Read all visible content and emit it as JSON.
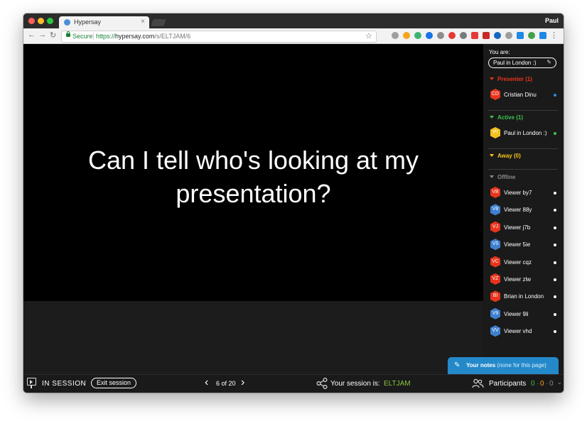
{
  "browser": {
    "user": "Paul",
    "tab_title": "Hypersay",
    "tab_close": "×",
    "secure_label": "Secure",
    "url_scheme": "https://",
    "url_host": "hypersay.com",
    "url_path": "/s/ELTJAM/6",
    "nav_back": "←",
    "nav_forward": "→",
    "nav_reload": "↻",
    "star": "☆",
    "menu": "⋮"
  },
  "slide": {
    "title_line1": "Can I tell who's looking at my",
    "title_line2": "presentation?"
  },
  "sidebar": {
    "you_are_label": "You are:",
    "your_name": "Paul in London :)",
    "edit_icon": "✎",
    "presenter_heading": "Presenter (1)",
    "active_heading": "Active (1)",
    "away_heading": "Away (0)",
    "offline_heading": "Offline",
    "presenter": [
      {
        "initials": "CD",
        "name": "Cristian Dinu",
        "color": "#e8341c",
        "dot": "#2b8fe6"
      }
    ],
    "active": [
      {
        "initials": "PI",
        "name": "Paul in London :)",
        "color": "#f6c21b",
        "dot": "#3cc24b"
      }
    ],
    "offline": [
      {
        "initials": "VB",
        "name": "Viewer by7",
        "color": "#e8341c",
        "dot": "#ffffff"
      },
      {
        "initials": "V8",
        "name": "Viewer 88y",
        "color": "#3f7fcf",
        "dot": "#ffffff"
      },
      {
        "initials": "VJ",
        "name": "Viewer j7b",
        "color": "#e8341c",
        "dot": "#ffffff"
      },
      {
        "initials": "V5",
        "name": "Viewer 5ie",
        "color": "#3f7fcf",
        "dot": "#ffffff"
      },
      {
        "initials": "VC",
        "name": "Viewer cqz",
        "color": "#e8341c",
        "dot": "#ffffff"
      },
      {
        "initials": "VZ",
        "name": "Viewer zlw",
        "color": "#e8341c",
        "dot": "#ffffff"
      },
      {
        "initials": "BI",
        "name": "Brian in London",
        "color": "#e8341c",
        "dot": "#ffffff"
      },
      {
        "initials": "V9",
        "name": "Viewer 9li",
        "color": "#3f7fcf",
        "dot": "#ffffff"
      },
      {
        "initials": "VV",
        "name": "Viewer vhd",
        "color": "#3f7fcf",
        "dot": "#ffffff"
      }
    ]
  },
  "notes": {
    "icon": "✎",
    "label": "Your notes",
    "sub": "(none for this page)"
  },
  "bottombar": {
    "in_session": "IN SESSION",
    "exit_label": "Exit session",
    "prev": "‹",
    "next": "›",
    "page_indicator": "6 of 20",
    "session_label": "Your session is:",
    "session_code": "ELTJAM",
    "participants_label": "Participants",
    "counts": [
      {
        "value": "0",
        "color": "#3cc24b"
      },
      {
        "value": "0",
        "color": "#f6a31b"
      },
      {
        "value": "0",
        "color": "#8a8a8a"
      }
    ],
    "chevron": "⌄"
  },
  "colors": {
    "accent": "#2489c9",
    "presenter": "#e8341c",
    "active": "#3cc24b",
    "away": "#f6c21b",
    "offline": "#9a9a9a"
  }
}
